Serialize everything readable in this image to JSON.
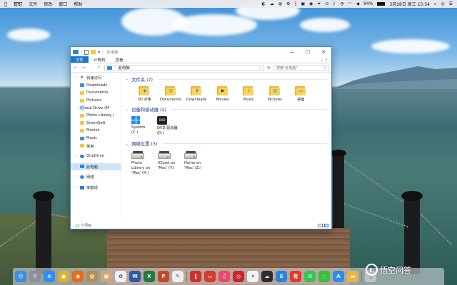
{
  "menubar": {
    "items": [
      "钉钉",
      "文件",
      "修改",
      "窗口",
      "帮助"
    ],
    "battery": "94%",
    "datetime": "3月28日 周三 15:54"
  },
  "window": {
    "title": "此电脑",
    "ribbon_tabs": [
      "文件",
      "计算机",
      "查看"
    ],
    "address": "此电脑",
    "search_placeholder": "搜索\"此电脑\"",
    "status": "12 个项目"
  },
  "sidebar": {
    "items": [
      {
        "label": "快速访问",
        "icon": "star-icon",
        "level": 0
      },
      {
        "label": "Downloads",
        "icon": "download-icon",
        "level": 1
      },
      {
        "label": "Documents",
        "icon": "folder-icon",
        "level": 1
      },
      {
        "label": "Pictures",
        "icon": "folder-icon",
        "level": 1
      },
      {
        "label": "iCloud Drive (M",
        "icon": "cloud-icon",
        "level": 1
      },
      {
        "label": "Photo Library (",
        "icon": "folder-icon",
        "level": 1
      },
      {
        "label": "GreenSoft",
        "icon": "folder-icon",
        "level": 1
      },
      {
        "label": "Movies",
        "icon": "folder-icon",
        "level": 1
      },
      {
        "label": "Music",
        "icon": "music-icon",
        "level": 1
      },
      {
        "label": "常用",
        "icon": "folder-icon",
        "level": 1
      },
      {
        "label": "OneDrive",
        "icon": "onedrive-icon",
        "level": 0
      },
      {
        "label": "此电脑",
        "icon": "pc-icon",
        "level": 0
      },
      {
        "label": "网络",
        "icon": "network-icon",
        "level": 0
      },
      {
        "label": "家庭组",
        "icon": "homegroup-icon",
        "level": 0
      }
    ]
  },
  "groups": {
    "folders": {
      "header": "文件夹 (7)",
      "items": [
        {
          "label": "3D 对象",
          "glyph": "◆"
        },
        {
          "label": "Documents",
          "glyph": "▤"
        },
        {
          "label": "Downloads",
          "glyph": "⬇"
        },
        {
          "label": "Movies",
          "glyph": "▶"
        },
        {
          "label": "Music",
          "glyph": "♪"
        },
        {
          "label": "Pictures",
          "glyph": "▨"
        },
        {
          "label": "桌面",
          "glyph": "▭"
        }
      ]
    },
    "devices": {
      "header": "设备和驱动器 (2)",
      "items": [
        {
          "label": "System (C:)",
          "icon": "windows-drive-icon"
        },
        {
          "label": "DVD 驱动器 (D:)",
          "icon": "dvd-icon",
          "badge": "DVD"
        }
      ]
    },
    "network": {
      "header": "网络位置 (3)",
      "items": [
        {
          "label": "Photo Library on 'Mac' (X:)"
        },
        {
          "label": "iCloud on 'Mac' (Y:)"
        },
        {
          "label": "Home on 'Mac' (Z:)"
        }
      ]
    }
  },
  "dock": {
    "apps": [
      {
        "name": "finder-icon",
        "color": "#3b8de0",
        "glyph": "☺"
      },
      {
        "name": "launchpad-icon",
        "color": "#8a8f98",
        "glyph": "⚲"
      },
      {
        "name": "safari-icon",
        "color": "#2d8cf0",
        "glyph": "⊙"
      },
      {
        "name": "chrome-icon",
        "color": "#e0b02b",
        "glyph": "●"
      },
      {
        "name": "firefox-icon",
        "color": "#e86a1a",
        "glyph": "◉"
      },
      {
        "name": "contacts-icon",
        "color": "#b58c54",
        "glyph": "@"
      },
      {
        "name": "preview-icon",
        "color": "#cfa87a",
        "glyph": "▣"
      },
      {
        "name": "photos-icon",
        "color": "#f0f0f0",
        "glyph": "✿"
      },
      {
        "name": "word-icon",
        "color": "#2b5aa8",
        "glyph": "W"
      },
      {
        "name": "excel-icon",
        "color": "#1f7a44",
        "glyph": "X"
      },
      {
        "name": "powerpoint-icon",
        "color": "#c8462a",
        "glyph": "P"
      },
      {
        "name": "textedit-icon",
        "color": "#eeeeee",
        "glyph": "✎"
      },
      {
        "name": "parallels-icon",
        "color": "#d0302a",
        "glyph": "‖"
      },
      {
        "name": "screen-icon",
        "color": "#d83a2e",
        "glyph": "▭"
      },
      {
        "name": "music-icon",
        "color": "#ea4a6a",
        "glyph": "♫"
      },
      {
        "name": "netease-music-icon",
        "color": "#c7262c",
        "glyph": "◎"
      },
      {
        "name": "qq-icon",
        "color": "#f2f2f2",
        "glyph": "✦"
      },
      {
        "name": "cloud-icon",
        "color": "#2d2d2d",
        "glyph": "☁"
      },
      {
        "name": "shazam-icon",
        "color": "#2a82e6",
        "glyph": "S"
      },
      {
        "name": "youdao-icon",
        "color": "#e23a2a",
        "glyph": "有"
      },
      {
        "name": "messages-icon",
        "color": "#38c453",
        "glyph": "✉"
      },
      {
        "name": "wechat-icon",
        "color": "#35c03f",
        "glyph": "◌"
      },
      {
        "name": "appstore-icon",
        "color": "#2d8cf0",
        "glyph": "A"
      },
      {
        "name": "folder-icon",
        "color": "#e9b444",
        "glyph": "▬"
      },
      {
        "name": "trash-icon",
        "color": "#bfc3c8",
        "glyph": "▯"
      }
    ]
  },
  "watermark": {
    "text": "悟空问答",
    "logo_glyph": "◐"
  }
}
